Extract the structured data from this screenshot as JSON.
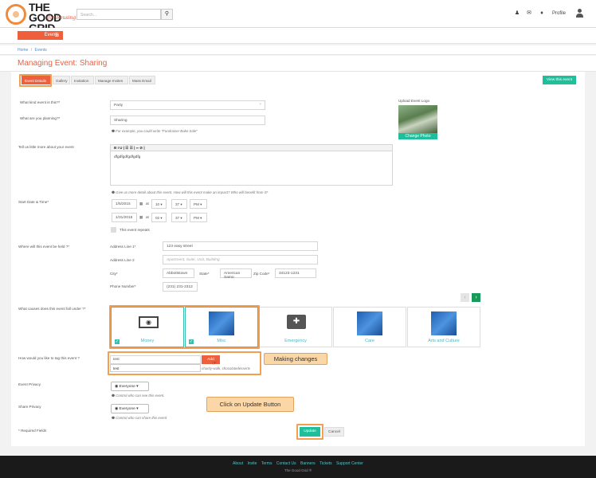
{
  "header": {
    "logo_text": "THE GOOD GRID",
    "logo_sub": "for Reusing",
    "search_placeholder": "Search...",
    "profile_label": "Profile"
  },
  "subnav": {
    "events_label": "Events"
  },
  "breadcrumb": {
    "home": "Home",
    "sep": "/",
    "events": "Events"
  },
  "page_title": "Managing Event: Sharing",
  "tabs": [
    {
      "label": "Event Details",
      "active": true
    },
    {
      "label": "Gallery"
    },
    {
      "label": "Invitation"
    },
    {
      "label": "Manage Invites"
    },
    {
      "label": "Mass Email"
    }
  ],
  "view_event_label": "View this event",
  "form": {
    "kind_label": "What kind event is this?*",
    "kind_value": "Party",
    "planning_label": "What are you planning?*",
    "planning_value": "Sharing",
    "planning_hint": "For example, you could write \"Fundraiser Bake Sale\"",
    "upload_logo_label": "Upload Event Logo",
    "change_photo_label": "Change Photo",
    "tell_label": "Tell us little more about your event",
    "rte_toolbar": "B  I  U  |  ☰  ☰  |  ∞  ⊘  |",
    "rte_value": "dfgdfgdfgdfgdfg",
    "tell_hint": "Give us more detail about this event. How will this event make an impact? Who will benefit from it?",
    "datetime_label": "Start Date & Time*",
    "start_date": "1/5/2015",
    "start_hour": "10",
    "start_min": "37",
    "start_ampm": "PM",
    "end_date": "1/31/2015",
    "end_hour": "02",
    "end_min": "37",
    "end_ampm": "PM",
    "at_label": "at",
    "repeats_label": "This event repeats",
    "where_label": "Where will this event be held ?*",
    "addr1_label": "Address Line 1*",
    "addr1_value": "123 easy street",
    "addr2_label": "Address Line 2",
    "addr2_placeholder": "Apartment, Suite, Unit, Building",
    "city_label": "City*",
    "city_value": "Abbottstown",
    "state_label": "State*",
    "state_value": "American Samo",
    "zip_label": "Zip Code*",
    "zip_value": "34123-1231",
    "phone_label": "Phone Number*",
    "phone_value": "(231) 231-2312",
    "causes_label": "What causes does this event fall under ?*",
    "causes": [
      {
        "label": "Money",
        "selected": true,
        "icon": "money-icon"
      },
      {
        "label": "Misc",
        "selected": true,
        "icon": "misc-image"
      },
      {
        "label": "Emergency",
        "selected": false,
        "icon": "ambulance-icon"
      },
      {
        "label": "Care",
        "selected": false,
        "icon": "care-image"
      },
      {
        "label": "Arts and Culture",
        "selected": false,
        "icon": "arts-image"
      }
    ],
    "tag_label": "How would you like to tag this event ?",
    "tag_value": "test",
    "tag_suggestion": "test",
    "tag_add_label": "Add",
    "tag_hint": "charity-walk, chocolatedesserts",
    "privacy_label": "Event Privacy",
    "privacy_value": "Everyone",
    "privacy_hint": "Control who can see this event.",
    "share_label": "Share Privacy",
    "share_value": "Everyone",
    "share_hint": "Control who can share this event",
    "required_note": "* Required Fields",
    "update_label": "Update",
    "cancel_label": "Cancel"
  },
  "callouts": {
    "making_changes": "Making changes",
    "click_update": "Click on Update Button"
  },
  "footer": {
    "links": [
      "About",
      "Invite",
      "Terms",
      "Contact Us",
      "Banners",
      "Tickets",
      "Support Center"
    ],
    "copyright": "The Good Grid ®"
  },
  "colors": {
    "accent": "#ef5f3c",
    "teal": "#1fbf9c",
    "highlight": "#f0a050"
  }
}
